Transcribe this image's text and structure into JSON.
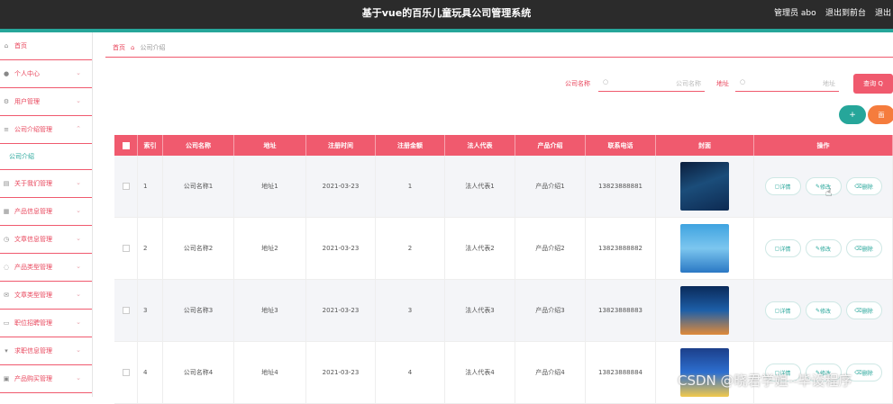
{
  "header": {
    "title": "基于vue的百乐儿童玩具公司管理系统",
    "user": "管理员 abo",
    "back_to_front": "退出到前台",
    "logout": "退出"
  },
  "sidebar": {
    "items": [
      {
        "label": "首页",
        "icon": "home-icon",
        "chevron": false
      },
      {
        "label": "个人中心",
        "icon": "person-icon",
        "chevron": true
      },
      {
        "label": "用户管理",
        "icon": "settings-icon",
        "chevron": true
      },
      {
        "label": "公司介绍管理",
        "icon": "list-icon",
        "chevron": true,
        "expanded": true
      },
      {
        "label": "公司介绍",
        "sub": true
      },
      {
        "label": "关于我们管理",
        "icon": "doc-icon",
        "chevron": true
      },
      {
        "label": "产品信息管理",
        "icon": "grid-icon",
        "chevron": true
      },
      {
        "label": "文章信息管理",
        "icon": "clock-icon",
        "chevron": true
      },
      {
        "label": "产品类型管理",
        "icon": "power-icon",
        "chevron": true
      },
      {
        "label": "文章类型管理",
        "icon": "mail-icon",
        "chevron": true
      },
      {
        "label": "职位招聘管理",
        "icon": "monitor-icon",
        "chevron": true
      },
      {
        "label": "求职信息管理",
        "icon": "shield-icon",
        "chevron": true
      },
      {
        "label": "产品购买管理",
        "icon": "cart-icon",
        "chevron": true
      }
    ]
  },
  "breadcrumb": {
    "home": "首页",
    "current": "公司介绍"
  },
  "search": {
    "company_label": "公司名称",
    "company_placeholder": "公司名称",
    "address_label": "地址",
    "address_placeholder": "地址",
    "query_label": "查询 Q"
  },
  "actions": {
    "add": "+",
    "delete": "面"
  },
  "table": {
    "headers": [
      "索引",
      "公司名称",
      "地址",
      "注册时间",
      "注册金额",
      "法人代表",
      "产品介绍",
      "联系电话",
      "封面",
      "操作"
    ],
    "rows": [
      {
        "index": "1",
        "name": "公司名称1",
        "address": "地址1",
        "date": "2021-03-23",
        "amount": "1",
        "legal": "法人代表1",
        "intro": "产品介绍1",
        "phone": "13823888881"
      },
      {
        "index": "2",
        "name": "公司名称2",
        "address": "地址2",
        "date": "2021-03-23",
        "amount": "2",
        "legal": "法人代表2",
        "intro": "产品介绍2",
        "phone": "13823888882"
      },
      {
        "index": "3",
        "name": "公司名称3",
        "address": "地址3",
        "date": "2021-03-23",
        "amount": "3",
        "legal": "法人代表3",
        "intro": "产品介绍3",
        "phone": "13823888883"
      },
      {
        "index": "4",
        "name": "公司名称4",
        "address": "地址4",
        "date": "2021-03-23",
        "amount": "4",
        "legal": "法人代表4",
        "intro": "产品介绍4",
        "phone": "13823888884"
      }
    ],
    "ops": {
      "detail": "详情",
      "edit": "修改",
      "delete": "删除"
    }
  },
  "watermark": "CSDN @晓君学姐--毕设程序",
  "colors": {
    "accent": "#f05a6e",
    "teal": "#26a69a",
    "orange": "#f57c3d",
    "header_bg": "#2b2b2b"
  }
}
